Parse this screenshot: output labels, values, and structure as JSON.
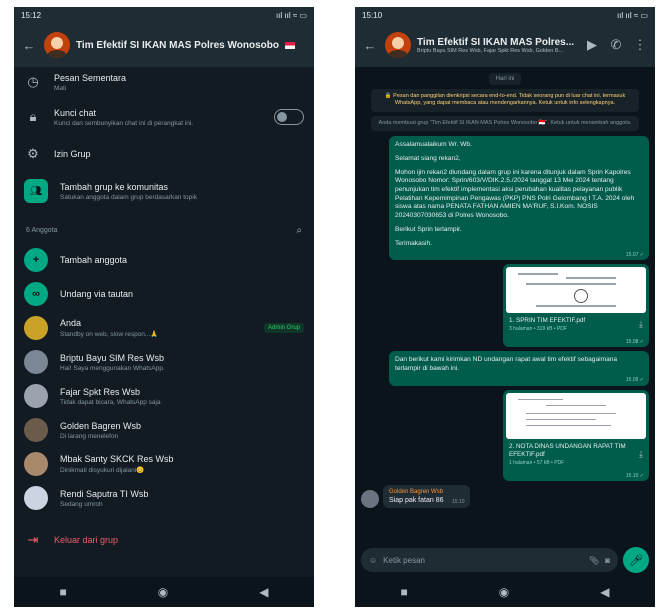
{
  "left": {
    "time": "15:12",
    "signal": "ııl ııl ≈ ▭",
    "title": "Tim Efektif SI IKAN MAS Polres Wonosobo",
    "settings": [
      {
        "label": "Pesan Sementara",
        "sub": "Mati",
        "icon": "timer-icon"
      },
      {
        "label": "Kunci chat",
        "sub": "Kunci dan sembunyikan chat ini di perangkat ini.",
        "icon": "lock-icon"
      },
      {
        "label": "Izin Grup",
        "icon": "gear-icon"
      }
    ],
    "community": {
      "label": "Tambah grup ke komunitas",
      "sub": "Satukan anggota dalam grup berdasarkan topik"
    },
    "members_header": "6 Anggota",
    "actions": [
      {
        "label": "Tambah anggota"
      },
      {
        "label": "Undang via tautan"
      }
    ],
    "members": [
      {
        "name": "Anda",
        "status": "Standby on web, slow respon...🙏",
        "badge": "Admin Grup",
        "color": "#c9a227"
      },
      {
        "name": "Briptu Bayu SIM Res Wsb",
        "status": "Hai! Saya menggunakan WhatsApp.",
        "color": "#7b8794"
      },
      {
        "name": "Fajar Spkt Res Wsb",
        "status": "Tidak dapat bicara, WhatsApp saja",
        "color": "#9ca3af"
      },
      {
        "name": "Golden Bagren Wsb",
        "status": "Di larang menelefon",
        "color": "#6b5b4b"
      },
      {
        "name": "Mbak Santy SKCK Res Wsb",
        "status": "Dinikmati disyukuri dijalani😊",
        "color": "#a8896c"
      },
      {
        "name": "Rendi Saputra TI Wsb",
        "status": "Sedang umroh",
        "color": "#cbd5e1"
      }
    ],
    "exit_label": "Keluar dari grup"
  },
  "right": {
    "time": "15:10",
    "signal": "ııl ııl ≈ ▭",
    "title": "Tim Efektif SI IKAN MAS Polres...",
    "subtitle": "Briptu Bayu SIM Res Wsb, Fajar Spkt Res Wsb, Golden B...",
    "date": "Hari ini",
    "encryption": "🔒 Pesan dan panggilan dienkripsi secara end-to-end. Tidak seorang pun di luar chat ini, termasuk WhatsApp, yang dapat membaca atau mendengarkannya. Ketuk untuk info selengkapnya.",
    "created": "Anda membuat grup \"Tim Efektif SI IKAN MAS Polres Wonosobo 🇮🇩\". Ketuk untuk menambah anggota.",
    "message1": {
      "lines": [
        "Assalamualaikum Wr. Wb.",
        "Selamat siang rekan2,",
        "Mohon ijin rekan2 diundang dalam grup ini karena ditunjuk dalam Sprin Kapolres Wonosobo Nomor: Sprin/603/V/DIK.2.5./2024 tanggal 13 Mei 2024 tentang penunjukan tim efektif implementasi aksi perubahan kualitas pelayanan publik Pelatihan Kepemimpinan Pengawas (PKP) PNS Polri Gelombang I T.A. 2024 oleh siswa atas nama PENATA FATHAN AMIEN MA'RUF, S.I.Kom. NOSIS 20240307030653 di Polres Wonosobo.",
        "Berikut Sprin terlampir.",
        "Terimakasih."
      ],
      "time": "15.07 ✓"
    },
    "doc1": {
      "name": "1. SPRIN TIM EFEKTIF.pdf",
      "meta": "3 halaman • 319 kB • PDF",
      "time": "15.08 ✓"
    },
    "message2": {
      "text": "Dan berikut kami kirimkan ND undangan rapat awal tim efektif sebagaimana terlampir di bawah ini.",
      "time": "15.09 ✓"
    },
    "doc2": {
      "name": "2. NOTA DINAS UNDANGAN RAPAT TIM EFEKTIF.pdf",
      "meta": "1 halaman • 57 kB • PDF",
      "time": "15.10 ✓"
    },
    "incoming": {
      "sender": "Golden Bagren Wsb",
      "text": "Siap pak fatan 86",
      "time": "15.10"
    },
    "composer_placeholder": "Ketik pesan"
  }
}
